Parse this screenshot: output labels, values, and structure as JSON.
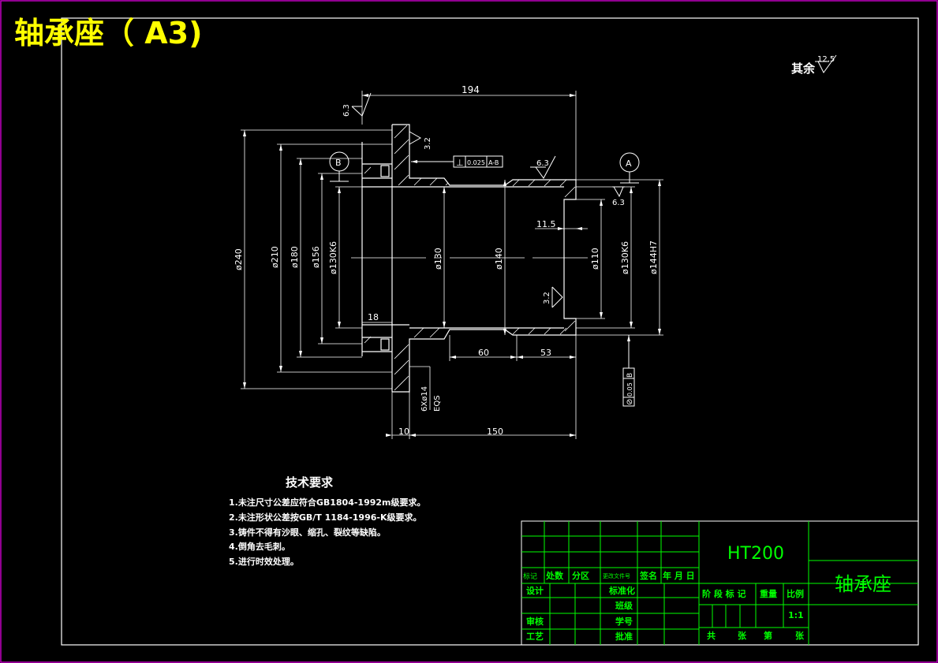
{
  "title": "轴承座（  A3)",
  "other_roughness": {
    "label": "其余",
    "value": "12.5"
  },
  "dims": {
    "length_top": "194",
    "d240": "ø240",
    "d210": "ø210",
    "d180": "ø180",
    "d156": "ø156",
    "d130k6_left": "ø130K6",
    "d130": "ø130",
    "d140": "ø140",
    "d110": "ø110",
    "d130k6_right": "ø130K6",
    "d144h7": "ø144H7",
    "len_11_5": "11.5",
    "len_18": "18",
    "len_60": "60",
    "len_53": "53",
    "len_10": "10",
    "len_150": "150",
    "holes": "6Xø14",
    "eqs": "EQS"
  },
  "roughness": {
    "r63_top": "6.3",
    "r32_flange": "3.2",
    "r63_mid": "6.3",
    "r63_right": "6.3",
    "r32_inner": "3.2"
  },
  "datums": {
    "a": "A",
    "b": "B"
  },
  "tolerances": {
    "perpendicularity": {
      "symbol": "⊥",
      "value": "0.025",
      "datum": "A-B"
    },
    "runout": {
      "symbol": "⊘",
      "value": "0.05",
      "datum": "B"
    }
  },
  "tech": {
    "heading": "技术要求",
    "lines": [
      "1.未注尺寸公差应符合GB1804-1992m级要求。",
      "2.未注形状公差按GB/T 1184-1996-K级要求。",
      "3.铸件不得有沙眼、缩孔、裂纹等缺陷。",
      "4.倒角去毛刺。",
      "5.进行时效处理。"
    ]
  },
  "titleblock": {
    "material": "HT200",
    "part_name": "轴承座",
    "row_labels": [
      "标记",
      "处数",
      "分区",
      "更改文件号",
      "签名",
      "年 月 日"
    ],
    "design": "设计",
    "standard": "标准化",
    "class": "班级",
    "review": "审核",
    "student_no": "学号",
    "process": "工艺",
    "approve": "批准",
    "stage_headers": [
      "阶 段 标 记",
      "重量",
      "比例"
    ],
    "scale": "1:1",
    "sheets": [
      "共",
      "张",
      "第",
      "张"
    ]
  }
}
